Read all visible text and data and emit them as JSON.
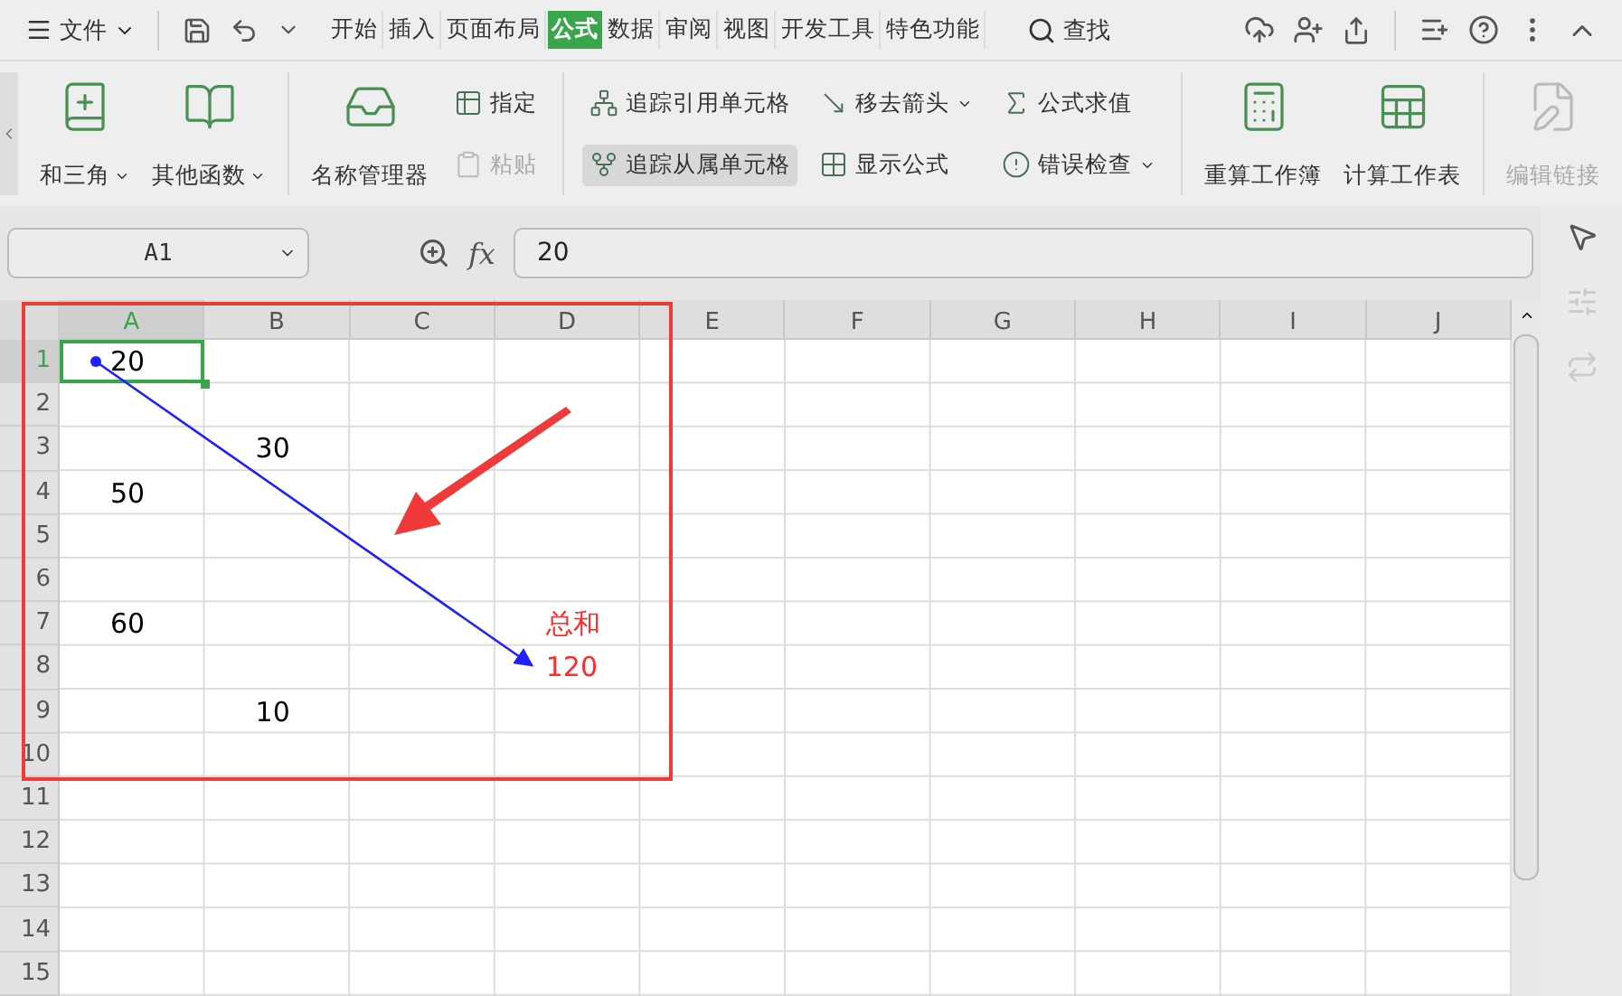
{
  "menu_bar": {
    "menu": "文件",
    "tabs": [
      {
        "label": "开始",
        "selected": false
      },
      {
        "label": "插入",
        "selected": false
      },
      {
        "label": "页面布局",
        "selected": false
      },
      {
        "label": "公式",
        "selected": true
      },
      {
        "label": "数据",
        "selected": false
      },
      {
        "label": "审阅",
        "selected": false
      },
      {
        "label": "视图",
        "selected": false
      },
      {
        "label": "开发工具",
        "selected": false
      },
      {
        "label": "特色功能",
        "selected": false
      }
    ],
    "search": "查找"
  },
  "ribbon": {
    "groups": [
      {
        "items": [
          {
            "kind": "large",
            "label": "和三角",
            "dropdown": true,
            "disabled": false
          },
          {
            "kind": "large",
            "label": "其他函数",
            "dropdown": true,
            "disabled": false
          }
        ]
      },
      {
        "items": [
          {
            "kind": "large",
            "label": "名称管理器",
            "dropdown": false,
            "disabled": false
          },
          {
            "kind": "column",
            "buttons": [
              {
                "label": "指定",
                "dropdown": false,
                "disabled": false,
                "hovered": false
              },
              {
                "label": "粘贴",
                "dropdown": false,
                "disabled": true,
                "hovered": false
              }
            ]
          }
        ]
      },
      {
        "items": [
          {
            "kind": "column",
            "buttons": [
              {
                "label": "追踪引用单元格",
                "dropdown": false,
                "disabled": false,
                "hovered": false
              },
              {
                "label": "追踪从属单元格",
                "dropdown": false,
                "disabled": false,
                "hovered": true
              }
            ]
          },
          {
            "kind": "column",
            "buttons": [
              {
                "label": "移去箭头",
                "dropdown": true,
                "disabled": false,
                "hovered": false
              },
              {
                "label": "显示公式",
                "dropdown": false,
                "disabled": false,
                "hovered": false
              }
            ]
          },
          {
            "kind": "column",
            "buttons": [
              {
                "label": "公式求值",
                "dropdown": false,
                "disabled": false,
                "hovered": false
              },
              {
                "label": "错误检查",
                "dropdown": true,
                "disabled": false,
                "hovered": false
              }
            ]
          }
        ]
      },
      {
        "items": [
          {
            "kind": "large",
            "label": "重算工作簿",
            "dropdown": false,
            "disabled": false
          },
          {
            "kind": "large",
            "label": "计算工作表",
            "dropdown": false,
            "disabled": false
          }
        ]
      },
      {
        "items": [
          {
            "kind": "large",
            "label": "编辑链接",
            "dropdown": false,
            "disabled": true
          }
        ]
      }
    ]
  },
  "formula_bar": {
    "name_box": "A1",
    "fx_label": "fx",
    "formula": "20"
  },
  "sheet": {
    "columns": [
      {
        "label": "A",
        "selected": true
      },
      {
        "label": "B",
        "selected": false
      },
      {
        "label": "C",
        "selected": false
      },
      {
        "label": "D",
        "selected": false
      },
      {
        "label": "E",
        "selected": false
      },
      {
        "label": "F",
        "selected": false
      },
      {
        "label": "G",
        "selected": false
      },
      {
        "label": "H",
        "selected": false
      },
      {
        "label": "I",
        "selected": false
      },
      {
        "label": "J",
        "selected": false
      }
    ],
    "rows": [
      {
        "label": "1",
        "selected": true,
        "cells": {
          "A": {
            "text": "20",
            "color": "#000000",
            "selected": true
          }
        }
      },
      {
        "label": "2",
        "selected": false,
        "cells": {}
      },
      {
        "label": "3",
        "selected": false,
        "cells": {
          "B": {
            "text": "30",
            "color": "#000000",
            "selected": false
          }
        }
      },
      {
        "label": "4",
        "selected": false,
        "cells": {
          "A": {
            "text": "50",
            "color": "#000000",
            "selected": false
          }
        }
      },
      {
        "label": "5",
        "selected": false,
        "cells": {}
      },
      {
        "label": "6",
        "selected": false,
        "cells": {}
      },
      {
        "label": "7",
        "selected": false,
        "cells": {
          "A": {
            "text": "60",
            "color": "#000000",
            "selected": false
          },
          "D": {
            "text": "总和",
            "color": "#ff2a2a",
            "selected": false
          }
        }
      },
      {
        "label": "8",
        "selected": false,
        "cells": {
          "D": {
            "text": "120",
            "color": "#ff2a2a",
            "selected": false
          }
        }
      },
      {
        "label": "9",
        "selected": false,
        "cells": {
          "B": {
            "text": "10",
            "color": "#000000",
            "selected": false
          }
        }
      },
      {
        "label": "10",
        "selected": false,
        "cells": {}
      },
      {
        "label": "11",
        "selected": false,
        "cells": {}
      },
      {
        "label": "12",
        "selected": false,
        "cells": {}
      },
      {
        "label": "13",
        "selected": false,
        "cells": {}
      },
      {
        "label": "14",
        "selected": false,
        "cells": {}
      },
      {
        "label": "15",
        "selected": false,
        "cells": {}
      }
    ]
  }
}
